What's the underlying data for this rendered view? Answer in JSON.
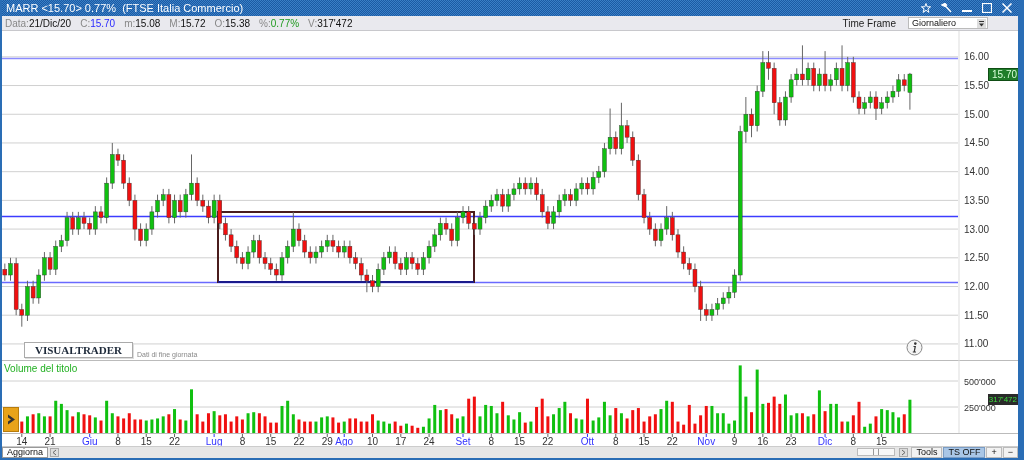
{
  "window": {
    "title": "MARR <15.70> 0.77%  (FTSE Italia Commercio)"
  },
  "quote": [
    {
      "label": "Data:",
      "value": "21/Dic/20",
      "kind": "plain"
    },
    {
      "label": "C:",
      "value": "15.70",
      "kind": "close"
    },
    {
      "label": "m:",
      "value": "15.08",
      "kind": "plain"
    },
    {
      "label": "M:",
      "value": "15.72",
      "kind": "plain"
    },
    {
      "label": "O:",
      "value": "15.38",
      "kind": "plain"
    },
    {
      "label": "%:",
      "value": "0.77%",
      "kind": "change"
    },
    {
      "label": "V:",
      "value": "317'472",
      "kind": "plain"
    }
  ],
  "time_frame": {
    "label": "Time Frame",
    "value": "Giornaliero"
  },
  "price_chart": {
    "last_price": "15.70",
    "logo": "VISUALTRADER",
    "note": "Dati di fine giornata",
    "chart_data": {
      "type": "candlestick",
      "grid": true,
      "ylim": [
        10.72,
        16.45
      ],
      "categories": [
        null,
        null,
        null,
        null,
        null,
        null,
        null,
        null,
        null,
        null,
        null,
        null,
        null,
        null,
        null,
        null,
        null,
        null,
        null,
        null,
        null,
        null,
        null,
        null,
        null,
        null,
        null,
        null,
        null,
        null,
        null,
        null,
        null,
        null,
        null,
        null,
        null,
        null,
        null,
        null,
        null,
        null,
        null,
        null,
        null,
        null,
        null,
        null,
        null,
        null,
        null,
        null,
        null,
        null,
        null,
        null,
        null,
        null,
        null,
        null,
        null,
        null,
        null,
        null,
        null,
        null,
        null,
        null,
        null,
        null,
        null,
        null,
        null,
        null,
        null,
        null,
        null,
        null,
        null,
        null,
        null,
        null,
        null,
        null,
        null,
        null,
        null,
        null,
        null,
        null,
        null,
        null,
        null,
        null,
        null,
        null,
        null,
        null,
        null,
        null,
        null,
        null,
        null,
        null,
        null,
        null,
        null,
        null,
        null,
        null,
        null,
        null,
        null,
        null,
        null,
        null,
        null,
        null,
        null,
        null,
        null,
        null,
        null,
        null,
        null,
        null,
        null,
        null,
        null,
        null,
        null,
        null,
        null,
        null,
        null,
        null,
        null,
        null,
        null,
        null,
        null,
        null,
        null,
        null,
        null,
        null,
        null,
        null,
        null,
        null,
        null,
        null,
        null,
        null,
        null,
        null,
        null,
        null,
        null,
        null,
        null,
        null,
        null,
        null,
        null,
        null,
        null,
        null,
        null
      ],
      "ohlc": [
        [
          12.3,
          12.4,
          12.1,
          12.2
        ],
        [
          12.2,
          12.5,
          12.1,
          12.4
        ],
        [
          12.4,
          12.5,
          11.5,
          11.6
        ],
        [
          11.6,
          11.7,
          11.3,
          11.5
        ],
        [
          11.5,
          12.1,
          11.4,
          12.0
        ],
        [
          12.0,
          12.1,
          11.7,
          11.8
        ],
        [
          11.8,
          12.3,
          11.7,
          12.2
        ],
        [
          12.2,
          12.6,
          12.1,
          12.5
        ],
        [
          12.5,
          12.6,
          12.2,
          12.3
        ],
        [
          12.3,
          12.8,
          12.2,
          12.7
        ],
        [
          12.7,
          12.9,
          12.6,
          12.8
        ],
        [
          12.8,
          13.3,
          12.7,
          13.2
        ],
        [
          13.2,
          13.3,
          12.9,
          13.0
        ],
        [
          13.0,
          13.3,
          12.9,
          13.2
        ],
        [
          13.2,
          13.3,
          13.0,
          13.1
        ],
        [
          13.1,
          13.2,
          12.9,
          13.0
        ],
        [
          13.0,
          13.4,
          12.9,
          13.3
        ],
        [
          13.3,
          13.4,
          13.1,
          13.2
        ],
        [
          13.2,
          13.9,
          13.1,
          13.8
        ],
        [
          13.8,
          14.5,
          13.7,
          14.3
        ],
        [
          14.3,
          14.4,
          14.1,
          14.2
        ],
        [
          14.2,
          14.3,
          13.7,
          13.8
        ],
        [
          13.8,
          13.9,
          13.4,
          13.5
        ],
        [
          13.5,
          13.6,
          12.8,
          13.0
        ],
        [
          13.0,
          13.1,
          12.7,
          12.8
        ],
        [
          12.8,
          13.1,
          12.7,
          13.0
        ],
        [
          13.0,
          13.4,
          12.9,
          13.3
        ],
        [
          13.3,
          13.6,
          13.2,
          13.5
        ],
        [
          13.5,
          13.7,
          13.4,
          13.6
        ],
        [
          13.6,
          13.7,
          13.1,
          13.2
        ],
        [
          13.2,
          13.6,
          13.1,
          13.5
        ],
        [
          13.5,
          13.6,
          13.2,
          13.3
        ],
        [
          13.3,
          13.7,
          13.2,
          13.6
        ],
        [
          13.6,
          14.3,
          13.5,
          13.8
        ],
        [
          13.8,
          13.9,
          13.4,
          13.5
        ],
        [
          13.5,
          13.6,
          13.3,
          13.4
        ],
        [
          13.4,
          13.5,
          13.1,
          13.2
        ],
        [
          13.2,
          13.6,
          13.1,
          13.5
        ],
        [
          13.5,
          13.6,
          13.0,
          13.1
        ],
        [
          13.1,
          13.2,
          12.8,
          12.9
        ],
        [
          12.9,
          13.0,
          12.6,
          12.7
        ],
        [
          12.7,
          12.8,
          12.4,
          12.5
        ],
        [
          12.5,
          12.6,
          12.3,
          12.4
        ],
        [
          12.4,
          12.7,
          12.3,
          12.6
        ],
        [
          12.6,
          12.9,
          12.5,
          12.8
        ],
        [
          12.8,
          12.9,
          12.4,
          12.5
        ],
        [
          12.5,
          12.6,
          12.3,
          12.4
        ],
        [
          12.4,
          12.5,
          12.2,
          12.3
        ],
        [
          12.3,
          12.4,
          12.1,
          12.2
        ],
        [
          12.2,
          12.6,
          12.1,
          12.5
        ],
        [
          12.5,
          12.8,
          12.4,
          12.7
        ],
        [
          12.7,
          13.3,
          12.6,
          13.0
        ],
        [
          13.0,
          13.1,
          12.7,
          12.8
        ],
        [
          12.8,
          12.9,
          12.5,
          12.6
        ],
        [
          12.6,
          12.7,
          12.4,
          12.5
        ],
        [
          12.5,
          12.7,
          12.4,
          12.6
        ],
        [
          12.6,
          12.8,
          12.5,
          12.7
        ],
        [
          12.7,
          12.9,
          12.6,
          12.8
        ],
        [
          12.8,
          12.9,
          12.6,
          12.7
        ],
        [
          12.7,
          12.8,
          12.5,
          12.6
        ],
        [
          12.6,
          12.8,
          12.5,
          12.7
        ],
        [
          12.7,
          12.8,
          12.4,
          12.5
        ],
        [
          12.5,
          12.6,
          12.3,
          12.4
        ],
        [
          12.4,
          12.5,
          12.1,
          12.2
        ],
        [
          12.2,
          12.3,
          11.9,
          12.1
        ],
        [
          12.1,
          12.2,
          11.9,
          12.0
        ],
        [
          12.0,
          12.4,
          11.9,
          12.3
        ],
        [
          12.3,
          12.6,
          12.2,
          12.5
        ],
        [
          12.5,
          12.7,
          12.4,
          12.6
        ],
        [
          12.6,
          12.7,
          12.3,
          12.4
        ],
        [
          12.4,
          12.5,
          12.2,
          12.3
        ],
        [
          12.3,
          12.6,
          12.2,
          12.5
        ],
        [
          12.5,
          12.6,
          12.3,
          12.4
        ],
        [
          12.4,
          12.5,
          12.2,
          12.3
        ],
        [
          12.3,
          12.6,
          12.2,
          12.5
        ],
        [
          12.5,
          12.8,
          12.4,
          12.7
        ],
        [
          12.7,
          13.0,
          12.6,
          12.9
        ],
        [
          12.9,
          13.2,
          12.8,
          13.1
        ],
        [
          13.1,
          13.2,
          12.9,
          13.0
        ],
        [
          13.0,
          13.1,
          12.7,
          12.8
        ],
        [
          12.8,
          13.3,
          12.7,
          13.2
        ],
        [
          13.2,
          13.4,
          13.1,
          13.3
        ],
        [
          13.3,
          13.4,
          13.0,
          13.1
        ],
        [
          13.1,
          13.2,
          12.9,
          13.0
        ],
        [
          13.0,
          13.3,
          12.9,
          13.2
        ],
        [
          13.2,
          13.5,
          13.1,
          13.4
        ],
        [
          13.4,
          13.6,
          13.3,
          13.5
        ],
        [
          13.5,
          13.7,
          13.4,
          13.6
        ],
        [
          13.6,
          13.7,
          13.3,
          13.4
        ],
        [
          13.4,
          13.7,
          13.3,
          13.6
        ],
        [
          13.6,
          13.8,
          13.5,
          13.7
        ],
        [
          13.7,
          13.9,
          13.6,
          13.8
        ],
        [
          13.8,
          13.9,
          13.6,
          13.7
        ],
        [
          13.7,
          13.9,
          13.6,
          13.8
        ],
        [
          13.8,
          13.9,
          13.5,
          13.6
        ],
        [
          13.6,
          13.7,
          13.2,
          13.3
        ],
        [
          13.3,
          13.4,
          13.0,
          13.1
        ],
        [
          13.1,
          13.4,
          13.0,
          13.3
        ],
        [
          13.3,
          13.6,
          13.2,
          13.5
        ],
        [
          13.5,
          13.7,
          13.4,
          13.6
        ],
        [
          13.6,
          13.7,
          13.4,
          13.5
        ],
        [
          13.5,
          13.8,
          13.4,
          13.7
        ],
        [
          13.7,
          13.9,
          13.6,
          13.8
        ],
        [
          13.8,
          13.9,
          13.6,
          13.7
        ],
        [
          13.7,
          14.0,
          13.6,
          13.9
        ],
        [
          13.9,
          14.1,
          13.8,
          14.0
        ],
        [
          14.0,
          14.5,
          13.9,
          14.4
        ],
        [
          14.4,
          15.1,
          14.3,
          14.6
        ],
        [
          14.6,
          14.7,
          14.3,
          14.4
        ],
        [
          14.4,
          15.2,
          14.3,
          14.8
        ],
        [
          14.8,
          14.9,
          14.5,
          14.6
        ],
        [
          14.6,
          14.7,
          14.1,
          14.2
        ],
        [
          14.2,
          14.3,
          13.5,
          13.6
        ],
        [
          13.6,
          13.7,
          13.1,
          13.2
        ],
        [
          13.2,
          13.3,
          12.9,
          13.0
        ],
        [
          13.0,
          13.1,
          12.7,
          12.8
        ],
        [
          12.8,
          13.1,
          12.7,
          13.0
        ],
        [
          13.0,
          13.4,
          12.9,
          13.2
        ],
        [
          13.2,
          13.3,
          12.8,
          12.9
        ],
        [
          12.9,
          13.0,
          12.5,
          12.6
        ],
        [
          12.6,
          12.7,
          12.3,
          12.4
        ],
        [
          12.4,
          12.5,
          12.2,
          12.3
        ],
        [
          12.3,
          12.4,
          11.9,
          12.0
        ],
        [
          12.0,
          12.1,
          11.4,
          11.6
        ],
        [
          11.6,
          11.7,
          11.4,
          11.5
        ],
        [
          11.5,
          11.7,
          11.4,
          11.6
        ],
        [
          11.6,
          11.8,
          11.5,
          11.7
        ],
        [
          11.7,
          11.9,
          11.6,
          11.8
        ],
        [
          11.8,
          12.0,
          11.7,
          11.9
        ],
        [
          11.9,
          12.3,
          11.8,
          12.2
        ],
        [
          12.2,
          14.8,
          12.1,
          14.7
        ],
        [
          14.7,
          15.3,
          14.5,
          15.0
        ],
        [
          15.0,
          15.1,
          14.6,
          14.8
        ],
        [
          14.8,
          15.5,
          14.7,
          15.4
        ],
        [
          15.4,
          16.1,
          15.3,
          15.9
        ],
        [
          15.9,
          16.1,
          15.6,
          15.8
        ],
        [
          15.8,
          15.9,
          15.0,
          15.2
        ],
        [
          15.2,
          15.3,
          14.8,
          14.9
        ],
        [
          14.9,
          15.4,
          14.8,
          15.3
        ],
        [
          15.3,
          15.7,
          15.2,
          15.6
        ],
        [
          15.6,
          15.8,
          15.5,
          15.7
        ],
        [
          15.7,
          16.2,
          15.5,
          15.6
        ],
        [
          15.6,
          15.9,
          15.5,
          15.8
        ],
        [
          15.8,
          15.9,
          15.4,
          15.5
        ],
        [
          15.5,
          15.8,
          15.4,
          15.7
        ],
        [
          15.7,
          16.1,
          15.4,
          15.5
        ],
        [
          15.5,
          15.7,
          15.4,
          15.6
        ],
        [
          15.6,
          15.9,
          15.5,
          15.8
        ],
        [
          15.8,
          16.2,
          15.4,
          15.5
        ],
        [
          15.5,
          16.0,
          15.4,
          15.9
        ],
        [
          15.9,
          16.0,
          15.2,
          15.3
        ],
        [
          15.3,
          15.4,
          15.0,
          15.1
        ],
        [
          15.1,
          15.3,
          15.0,
          15.2
        ],
        [
          15.2,
          15.4,
          15.1,
          15.3
        ],
        [
          15.3,
          15.4,
          14.9,
          15.1
        ],
        [
          15.1,
          15.3,
          15.0,
          15.2
        ],
        [
          15.2,
          15.4,
          15.1,
          15.3
        ],
        [
          15.3,
          15.5,
          15.2,
          15.4
        ],
        [
          15.4,
          15.7,
          15.3,
          15.6
        ],
        [
          15.6,
          15.7,
          15.4,
          15.5
        ],
        [
          15.38,
          15.72,
          15.08,
          15.7
        ],
        null,
        null,
        null,
        null,
        null,
        null,
        null,
        null
      ],
      "yticks": [
        {
          "value": 11,
          "label": "11.00"
        },
        {
          "value": 11.5,
          "label": "11.50"
        },
        {
          "value": 12,
          "label": "12.00"
        },
        {
          "value": 12.5,
          "label": "12.50"
        },
        {
          "value": 13,
          "label": "13.00"
        },
        {
          "value": 13.5,
          "label": "13.50"
        },
        {
          "value": 14,
          "label": "14.00"
        },
        {
          "value": 14.5,
          "label": "14.50"
        },
        {
          "value": 15,
          "label": "15.00"
        },
        {
          "value": 15.5,
          "label": "15.50"
        },
        {
          "value": 16,
          "label": "16.00"
        }
      ],
      "ref_lines": [
        {
          "value": 15.97,
          "axis": "y",
          "color": "#8c8cff"
        },
        {
          "value": 13.22,
          "axis": "y",
          "color": "#3c3cff"
        },
        {
          "value": 12.07,
          "axis": "y",
          "color": "#6a6aff"
        }
      ]
    }
  },
  "volume_chart": {
    "title": "Volume del titolo",
    "last_volume": "317'472",
    "chart_data": {
      "type": "bar",
      "grid": true,
      "ylim": [
        0,
        702000
      ],
      "categories": [
        null,
        null,
        null,
        "14",
        null,
        null,
        null,
        null,
        "21",
        null,
        null,
        null,
        null,
        null,
        null,
        "Giu",
        null,
        null,
        null,
        null,
        "8",
        null,
        null,
        null,
        null,
        "15",
        null,
        null,
        null,
        null,
        "22",
        null,
        null,
        null,
        null,
        null,
        null,
        "Lug",
        null,
        null,
        null,
        null,
        "8",
        null,
        null,
        null,
        null,
        "15",
        null,
        null,
        null,
        null,
        "22",
        null,
        null,
        null,
        null,
        "29",
        null,
        null,
        "Ago",
        null,
        null,
        null,
        null,
        "10",
        null,
        null,
        null,
        null,
        "17",
        null,
        null,
        null,
        null,
        "24",
        null,
        null,
        null,
        null,
        null,
        "Set",
        null,
        null,
        null,
        null,
        "8",
        null,
        null,
        null,
        null,
        "15",
        null,
        null,
        null,
        null,
        "22",
        null,
        null,
        null,
        null,
        null,
        null,
        "Ott",
        null,
        null,
        null,
        null,
        "8",
        null,
        null,
        null,
        null,
        "15",
        null,
        null,
        null,
        null,
        "22",
        null,
        null,
        null,
        null,
        null,
        "Nov",
        null,
        null,
        null,
        null,
        "9",
        null,
        null,
        null,
        null,
        "16",
        null,
        null,
        null,
        null,
        "23",
        null,
        null,
        null,
        null,
        null,
        "Dic",
        null,
        null,
        null,
        null,
        "8",
        null,
        null,
        null,
        null,
        "15",
        null,
        null,
        null,
        null,
        null,
        null,
        null,
        null,
        null,
        null,
        null,
        null,
        null
      ],
      "values": [
        null,
        null,
        null,
        110000,
        160000,
        180000,
        190000,
        160000,
        160000,
        310000,
        280000,
        220000,
        160000,
        200000,
        180000,
        170000,
        150000,
        120000,
        310000,
        190000,
        160000,
        140000,
        190000,
        130000,
        130000,
        120000,
        130000,
        140000,
        160000,
        180000,
        230000,
        130000,
        120000,
        420000,
        180000,
        110000,
        190000,
        210000,
        170000,
        180000,
        110000,
        160000,
        130000,
        190000,
        200000,
        190000,
        160000,
        100000,
        100000,
        260000,
        310000,
        180000,
        130000,
        110000,
        110000,
        110000,
        150000,
        160000,
        150000,
        100000,
        110000,
        140000,
        140000,
        110000,
        110000,
        180000,
        120000,
        110000,
        90000,
        110000,
        70000,
        90000,
        70000,
        50000,
        60000,
        140000,
        270000,
        220000,
        230000,
        180000,
        140000,
        160000,
        330000,
        350000,
        160000,
        270000,
        260000,
        190000,
        300000,
        170000,
        130000,
        200000,
        100000,
        110000,
        250000,
        330000,
        160000,
        180000,
        240000,
        300000,
        190000,
        140000,
        130000,
        330000,
        120000,
        150000,
        300000,
        170000,
        240000,
        190000,
        140000,
        220000,
        240000,
        110000,
        160000,
        180000,
        230000,
        310000,
        300000,
        110000,
        80000,
        270000,
        90000,
        170000,
        260000,
        260000,
        190000,
        190000,
        90000,
        120000,
        650000,
        350000,
        200000,
        610000,
        280000,
        290000,
        350000,
        280000,
        370000,
        170000,
        190000,
        190000,
        160000,
        180000,
        410000,
        210000,
        280000,
        280000,
        110000,
        110000,
        170000,
        300000,
        60000,
        90000,
        160000,
        230000,
        220000,
        200000,
        150000,
        180000,
        320000,
        null,
        null,
        null,
        null,
        null,
        null,
        null,
        null
      ],
      "yticks": [
        {
          "value": 250000,
          "label": "250'000"
        },
        {
          "value": 500000,
          "label": "500'000"
        }
      ]
    }
  },
  "bottom_bar": {
    "update_button": "Aggiorna",
    "buttons": [
      {
        "label": "Tools",
        "selected": false
      },
      {
        "label": "TS OFF",
        "selected": true
      },
      {
        "label": "+",
        "selected": false
      },
      {
        "label": "−",
        "selected": false
      }
    ]
  }
}
